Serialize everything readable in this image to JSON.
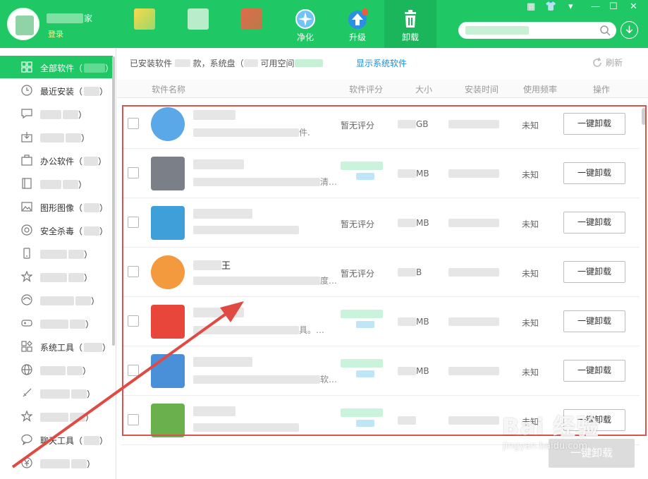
{
  "header": {
    "username_suffix": "家",
    "login_label": "登录",
    "nav": [
      {
        "label": "",
        "icon": "app-icon-1"
      },
      {
        "label": "",
        "icon": "app-icon-2"
      },
      {
        "label": "",
        "icon": "app-icon-3"
      },
      {
        "label": "净化",
        "icon": "clean-icon"
      },
      {
        "label": "升级",
        "icon": "upgrade-icon"
      },
      {
        "label": "卸载",
        "icon": "trash-icon"
      }
    ],
    "window_controls": {
      "grid": "▦",
      "skin": "👕",
      "menu": "▾",
      "min": "—",
      "max": "☐",
      "close": "✕"
    },
    "search_placeholder": ""
  },
  "sidebar": {
    "items": [
      {
        "label": "全部软件（",
        "suffix": "）",
        "icon": "grid-icon"
      },
      {
        "label": "最近安装（",
        "suffix": "）",
        "icon": "clock-icon"
      },
      {
        "label": "",
        "suffix": "）",
        "icon": "chat-icon"
      },
      {
        "label": "",
        "suffix": "）",
        "icon": "download-icon"
      },
      {
        "label": "办公软件（",
        "suffix": "）",
        "icon": "briefcase-icon"
      },
      {
        "label": "",
        "suffix": "）",
        "icon": "book-icon"
      },
      {
        "label": "图形图像（",
        "suffix": "）",
        "icon": "image-icon"
      },
      {
        "label": "安全杀毒（",
        "suffix": "）",
        "icon": "shield-icon"
      },
      {
        "label": "",
        "suffix": "）",
        "icon": "phone-icon"
      },
      {
        "label": "",
        "suffix": "）",
        "icon": "star-icon"
      },
      {
        "label": "",
        "suffix": "）",
        "icon": "browser-icon"
      },
      {
        "label": "",
        "suffix": "）",
        "icon": "gamepad-icon"
      },
      {
        "label": "系统工具（",
        "suffix": "）",
        "icon": "tools-icon"
      },
      {
        "label": "",
        "suffix": "）",
        "icon": "globe-icon"
      },
      {
        "label": "",
        "suffix": "）",
        "icon": "sword-icon"
      },
      {
        "label": "",
        "suffix": "）",
        "icon": "star-outline-icon"
      },
      {
        "label": "聊天工具（",
        "suffix": "）",
        "icon": "bubble-icon"
      },
      {
        "label": "",
        "suffix": "）",
        "icon": "money-icon"
      }
    ]
  },
  "main": {
    "info_text_1": "已安装软件",
    "info_text_2": "款，系统盘（",
    "info_text_3": "可用空间",
    "show_system": "显示系统软件",
    "refresh": "刷新",
    "columns": {
      "name": "软件名称",
      "rating": "软件评分",
      "size": "大小",
      "time": "安装时间",
      "freq": "使用频率",
      "action": "操作"
    },
    "rows": [
      {
        "name": "",
        "desc_end": "件.",
        "rating": "暂无评分",
        "size_unit": "GB",
        "freq": "未知",
        "button": "一键卸载",
        "icon_color": "#5aa8e8"
      },
      {
        "name": "",
        "desc_end": "清…",
        "rating": "",
        "size_unit": "MB",
        "freq": "未知",
        "button": "一键卸载",
        "icon_color": "#7a7f88"
      },
      {
        "name": "",
        "desc_end": "",
        "rating": "暂无评分",
        "size_unit": "MB",
        "freq": "未知",
        "button": "一键卸载",
        "icon_color": "#3f9fd8"
      },
      {
        "name": "王",
        "desc_end": "度…",
        "rating": "暂无评分",
        "size_unit": "B",
        "freq": "未知",
        "button": "一键卸载",
        "icon_color": "#f39a3e"
      },
      {
        "name": "",
        "desc_end": "具。…",
        "rating": "",
        "size_unit": "MB",
        "freq": "未知",
        "button": "一键卸载",
        "icon_color": "#e8463a"
      },
      {
        "name": "",
        "desc_end": "软…",
        "rating": "",
        "size_unit": "MB",
        "freq": "未知",
        "button": "一键卸载",
        "icon_color": "#4a90d9"
      },
      {
        "name": "",
        "desc_end": "",
        "rating": "",
        "size_unit": "",
        "freq": "未知",
        "button": "一键卸载",
        "icon_color": "#6ab04c"
      }
    ]
  },
  "bottom_button": "一键卸载",
  "watermark": {
    "text": "Bai 经验",
    "sub": "jingyan.baidu.com"
  },
  "colors": {
    "accent": "#1fc865",
    "annotation_red": "#d9534f"
  }
}
